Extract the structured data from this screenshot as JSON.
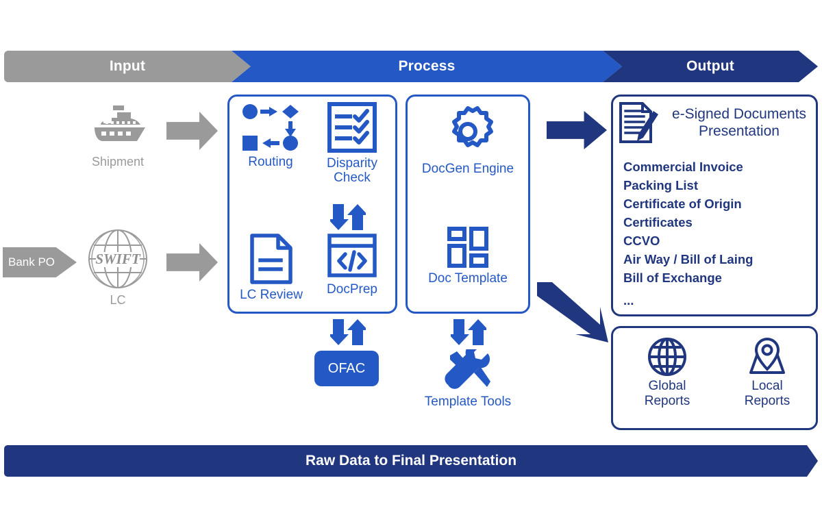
{
  "banner": {
    "input": "Input",
    "process": "Process",
    "output": "Output",
    "colors": {
      "input": "#9a9a9a",
      "process": "#2458c4",
      "output": "#20367e"
    }
  },
  "footer": {
    "label": "Raw Data to Final Presentation",
    "color": "#20367e"
  },
  "input": {
    "shipment": {
      "icon": "ship-icon",
      "label": "Shipment"
    },
    "lc": {
      "icon": "swift-globe-icon",
      "icon_text": "SWIFT",
      "label": "LC"
    },
    "bank_po": {
      "label": "Bank PO"
    },
    "arrows": [
      {
        "icon": "gray-arrow-right-icon"
      },
      {
        "icon": "gray-arrow-right-icon"
      }
    ]
  },
  "process": {
    "box1": {
      "cells": [
        {
          "icon": "routing-flow-icon",
          "label": "Routing"
        },
        {
          "icon": "checklist-icon",
          "label": "Disparity\nCheck"
        },
        {
          "icon": "document-lines-icon",
          "label": "LC Review"
        },
        {
          "icon": "code-window-icon",
          "label": "DocPrep"
        }
      ],
      "connector": {
        "icon": "up-down-arrows-icon"
      }
    },
    "box2": {
      "cells": [
        {
          "icon": "gear-icon",
          "label": "DocGen Engine"
        },
        {
          "icon": "blocks-grid-icon",
          "label": "Doc Template"
        }
      ]
    },
    "ofac": {
      "connector": {
        "icon": "up-down-arrows-icon"
      },
      "label": "OFAC"
    },
    "template_tools": {
      "connector": {
        "icon": "up-down-arrows-icon"
      },
      "icon": "wrench-screwdriver-icon",
      "label": "Template Tools"
    }
  },
  "output": {
    "arrow_right": {
      "icon": "navy-arrow-right-icon"
    },
    "arrow_diagonal": {
      "icon": "navy-arrow-down-right-icon"
    },
    "documents": {
      "icon": "signed-document-pen-icon",
      "title": "e-Signed Documents\nPresentation",
      "items": [
        "Commercial Invoice",
        "Packing List",
        "Certificate of Origin",
        "Certificates",
        "CCVO",
        "Air Way / Bill of Laing",
        "Bill of Exchange"
      ],
      "more": "..."
    },
    "reports": [
      {
        "icon": "globe-icon",
        "label": "Global\nReports"
      },
      {
        "icon": "map-pin-icon",
        "label": "Local\nReports"
      }
    ]
  }
}
